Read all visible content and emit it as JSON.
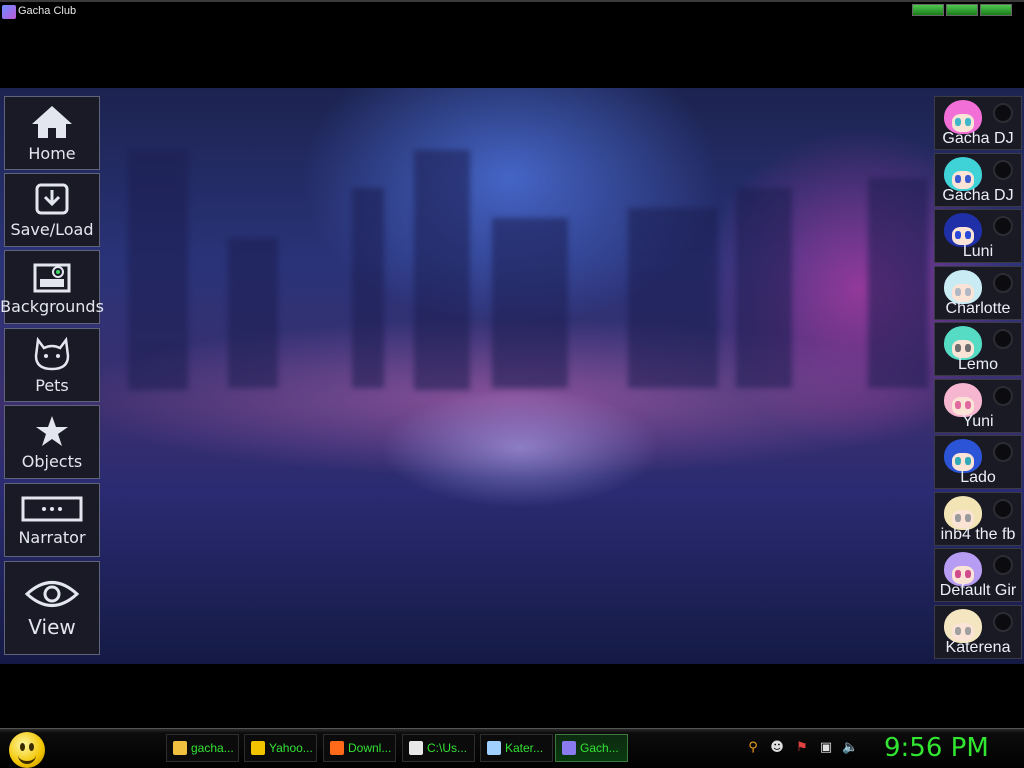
{
  "window": {
    "title": "Gacha Club"
  },
  "menu": [
    {
      "label": "Home",
      "icon": "home-icon"
    },
    {
      "label": "Save/Load",
      "icon": "save-load-icon"
    },
    {
      "label": "Backgrounds",
      "icon": "backgrounds-icon"
    },
    {
      "label": "Pets",
      "icon": "cat-icon"
    },
    {
      "label": "Objects",
      "icon": "star-icon"
    },
    {
      "label": "Narrator",
      "icon": "narrator-box-icon"
    },
    {
      "label": "View",
      "icon": "eye-icon"
    }
  ],
  "characters": [
    {
      "name": "Gacha DJ",
      "hair": "#f26fd8",
      "eyes": "#3fb7c9"
    },
    {
      "name": "Gacha DJ",
      "hair": "#3fd3d8",
      "eyes": "#3a5ad0"
    },
    {
      "name": "Luni",
      "hair": "#1f2fa8",
      "eyes": "#2848d8"
    },
    {
      "name": "Charlotte",
      "hair": "#c9ecf4",
      "eyes": "#b0b8c4"
    },
    {
      "name": "Lemo",
      "hair": "#56dcc4",
      "eyes": "#6e6e6e"
    },
    {
      "name": "Yuni",
      "hair": "#f7b6d0",
      "eyes": "#e06aa0"
    },
    {
      "name": "Lado",
      "hair": "#2b55d6",
      "eyes": "#32a9b8"
    },
    {
      "name": "inb4 the fb",
      "hair": "#f2e4b4",
      "eyes": "#9a9a9a"
    },
    {
      "name": "Default Gir",
      "hair": "#b69cf2",
      "eyes": "#d04a8e"
    },
    {
      "name": "Katerena",
      "hair": "#f4e6c0",
      "eyes": "#a0a0a0"
    }
  ],
  "taskbar": {
    "tasks": [
      {
        "label": "gacha...",
        "icon": "folder-icon",
        "color": "#f0c040"
      },
      {
        "label": "Yahoo...",
        "icon": "yahoo-smiley-icon",
        "color": "#f2c400"
      },
      {
        "label": "Downl...",
        "icon": "firefox-icon",
        "color": "#ff6a1a"
      },
      {
        "label": "C:\\Us...",
        "icon": "7zip-icon",
        "color": "#e8e8e8"
      },
      {
        "label": "Kater...",
        "icon": "notepad-icon",
        "color": "#9fd0ff"
      },
      {
        "label": "Gach...",
        "icon": "gacha-club-icon",
        "color": "#8a7cf0",
        "active": true
      }
    ],
    "clock": "9:56 PM"
  },
  "colors": {
    "taskbar_text": "#33e233",
    "clock": "#31e531",
    "menu_button_bg": "#1a1a26"
  }
}
